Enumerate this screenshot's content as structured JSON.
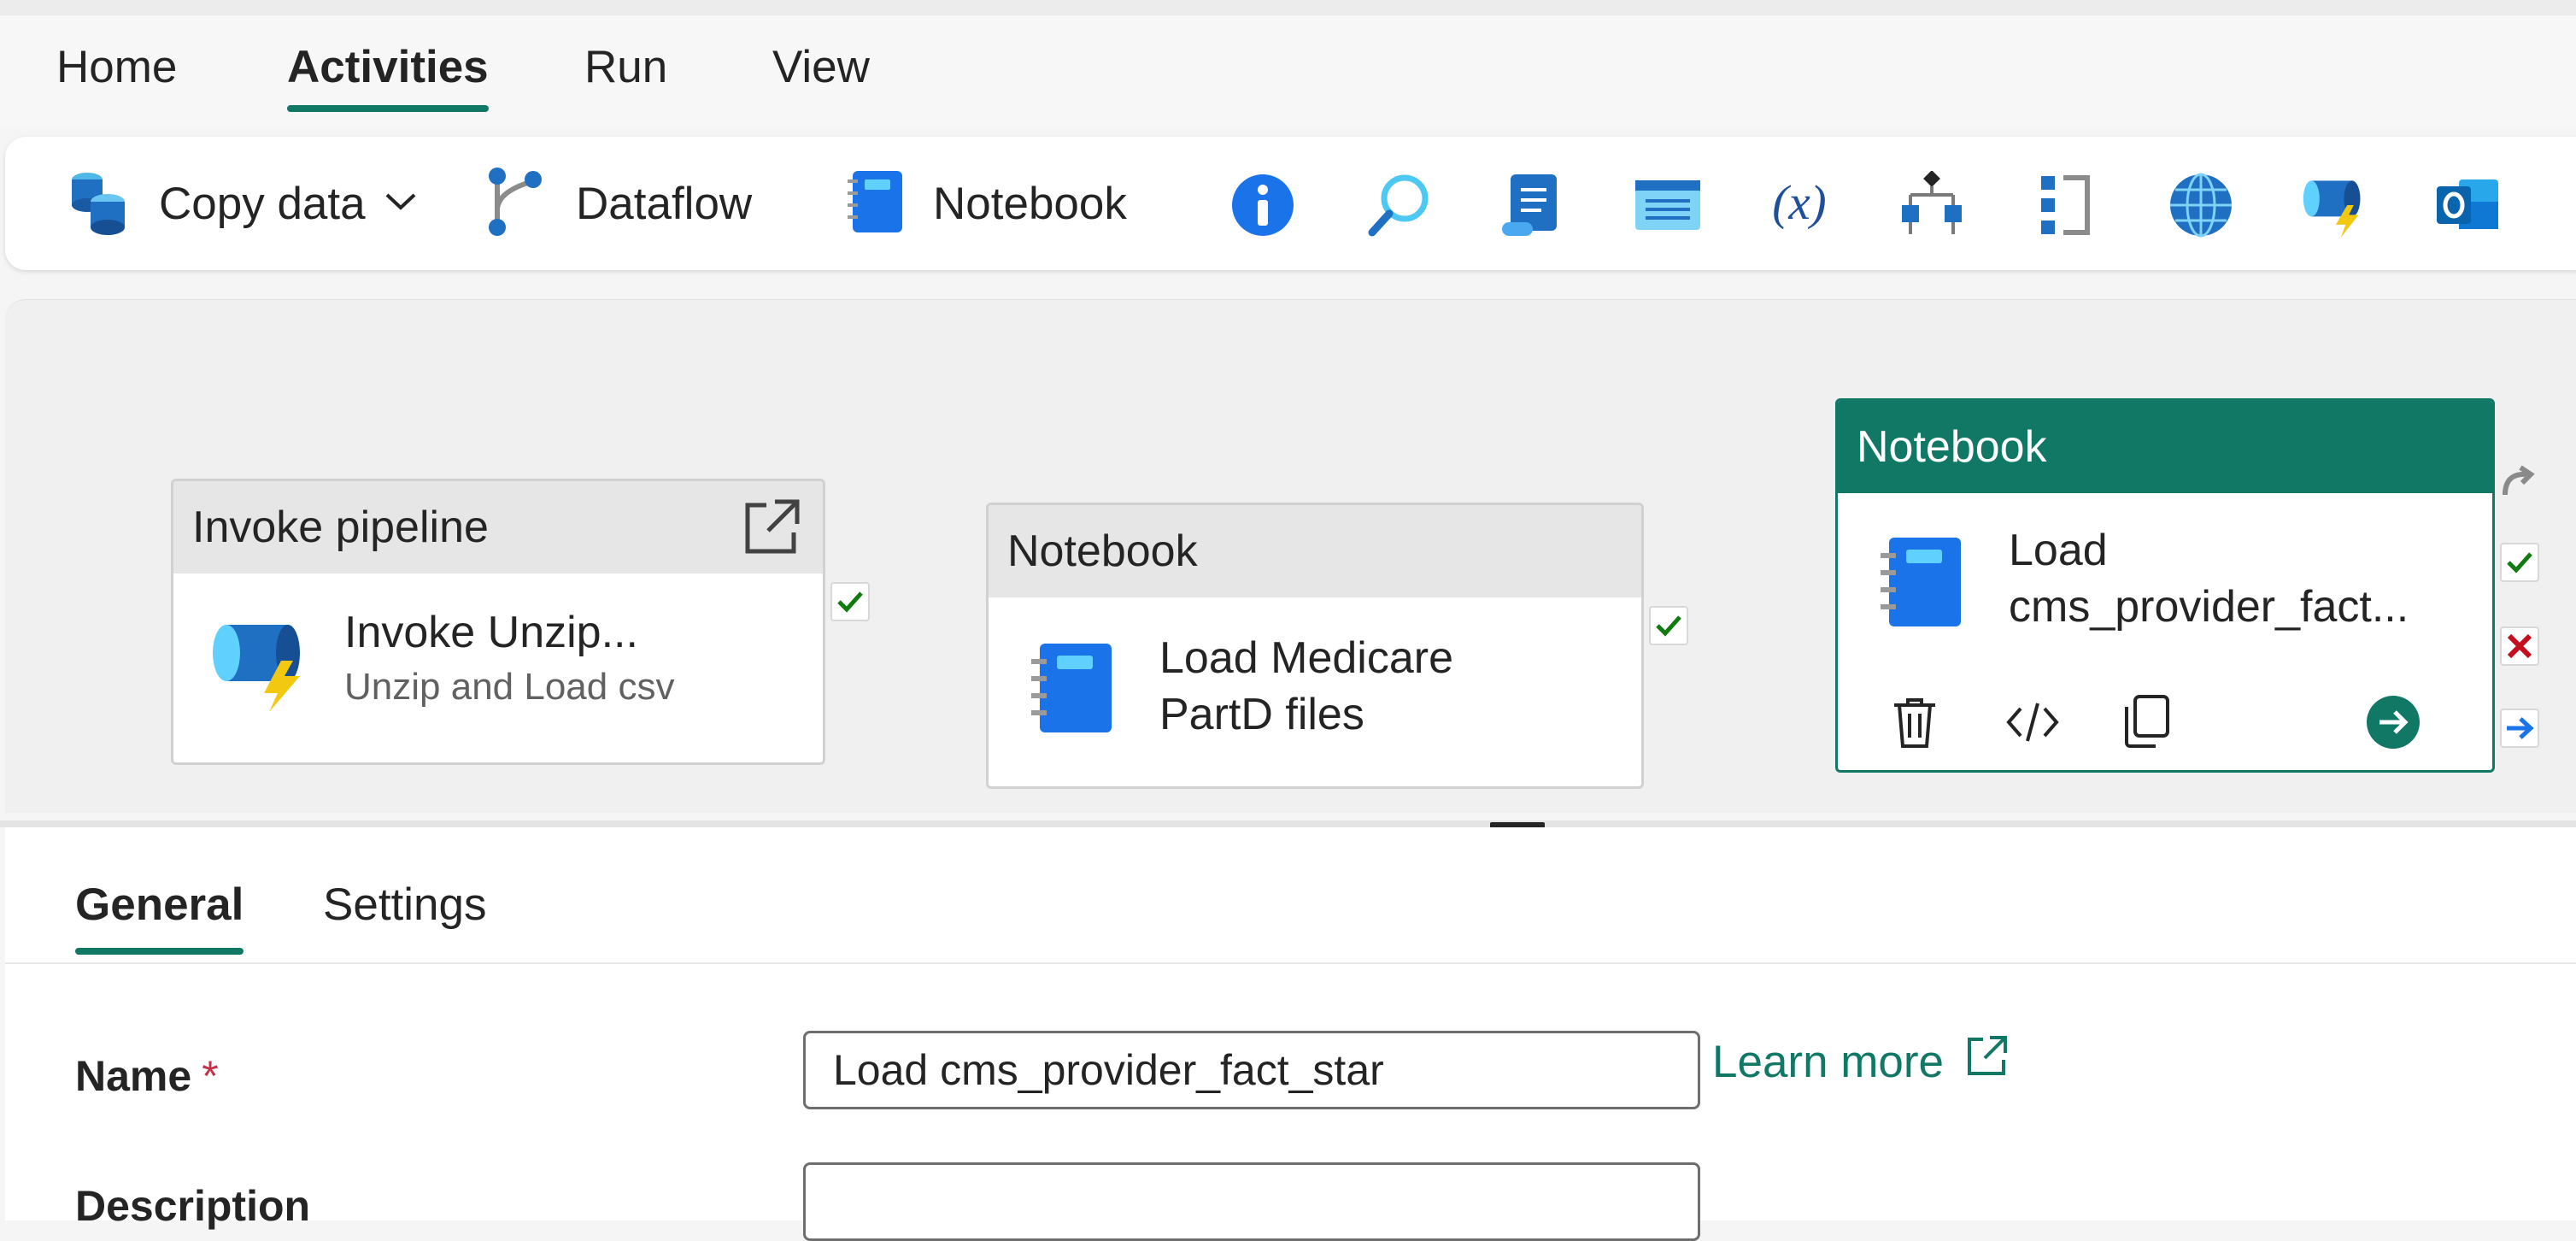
{
  "menu": {
    "tabs": [
      {
        "label": "Home"
      },
      {
        "label": "Activities"
      },
      {
        "label": "Run"
      },
      {
        "label": "View"
      }
    ],
    "active": "Activities"
  },
  "ribbon": {
    "copy_data": "Copy data",
    "dataflow": "Dataflow",
    "notebook": "Notebook",
    "icons": [
      "info-icon",
      "lookup-icon",
      "script-icon",
      "stored-procedure-icon",
      "set-variable-icon",
      "switch-icon",
      "filter-icon",
      "web-icon",
      "invoke-pipeline-icon",
      "outlook-icon"
    ]
  },
  "canvas": {
    "activities": [
      {
        "type": "Invoke pipeline",
        "name": "Invoke Unzip...",
        "subtitle": "Unzip and Load csv"
      },
      {
        "type": "Notebook",
        "name_line1": "Load Medicare",
        "name_line2": "PartD files"
      },
      {
        "type": "Notebook",
        "name_line1": "Load",
        "name_line2": "cms_provider_fact..."
      }
    ]
  },
  "panel": {
    "tabs": [
      {
        "label": "General"
      },
      {
        "label": "Settings"
      }
    ],
    "name_label": "Name",
    "required_mark": "*",
    "name_value": "Load cms_provider_fact_star",
    "learn_more": "Learn more",
    "description_label": "Description",
    "description_value": ""
  },
  "colors": {
    "accent": "#117865",
    "success": "#107c10",
    "failure": "#c50f1f",
    "link": "#117865"
  }
}
